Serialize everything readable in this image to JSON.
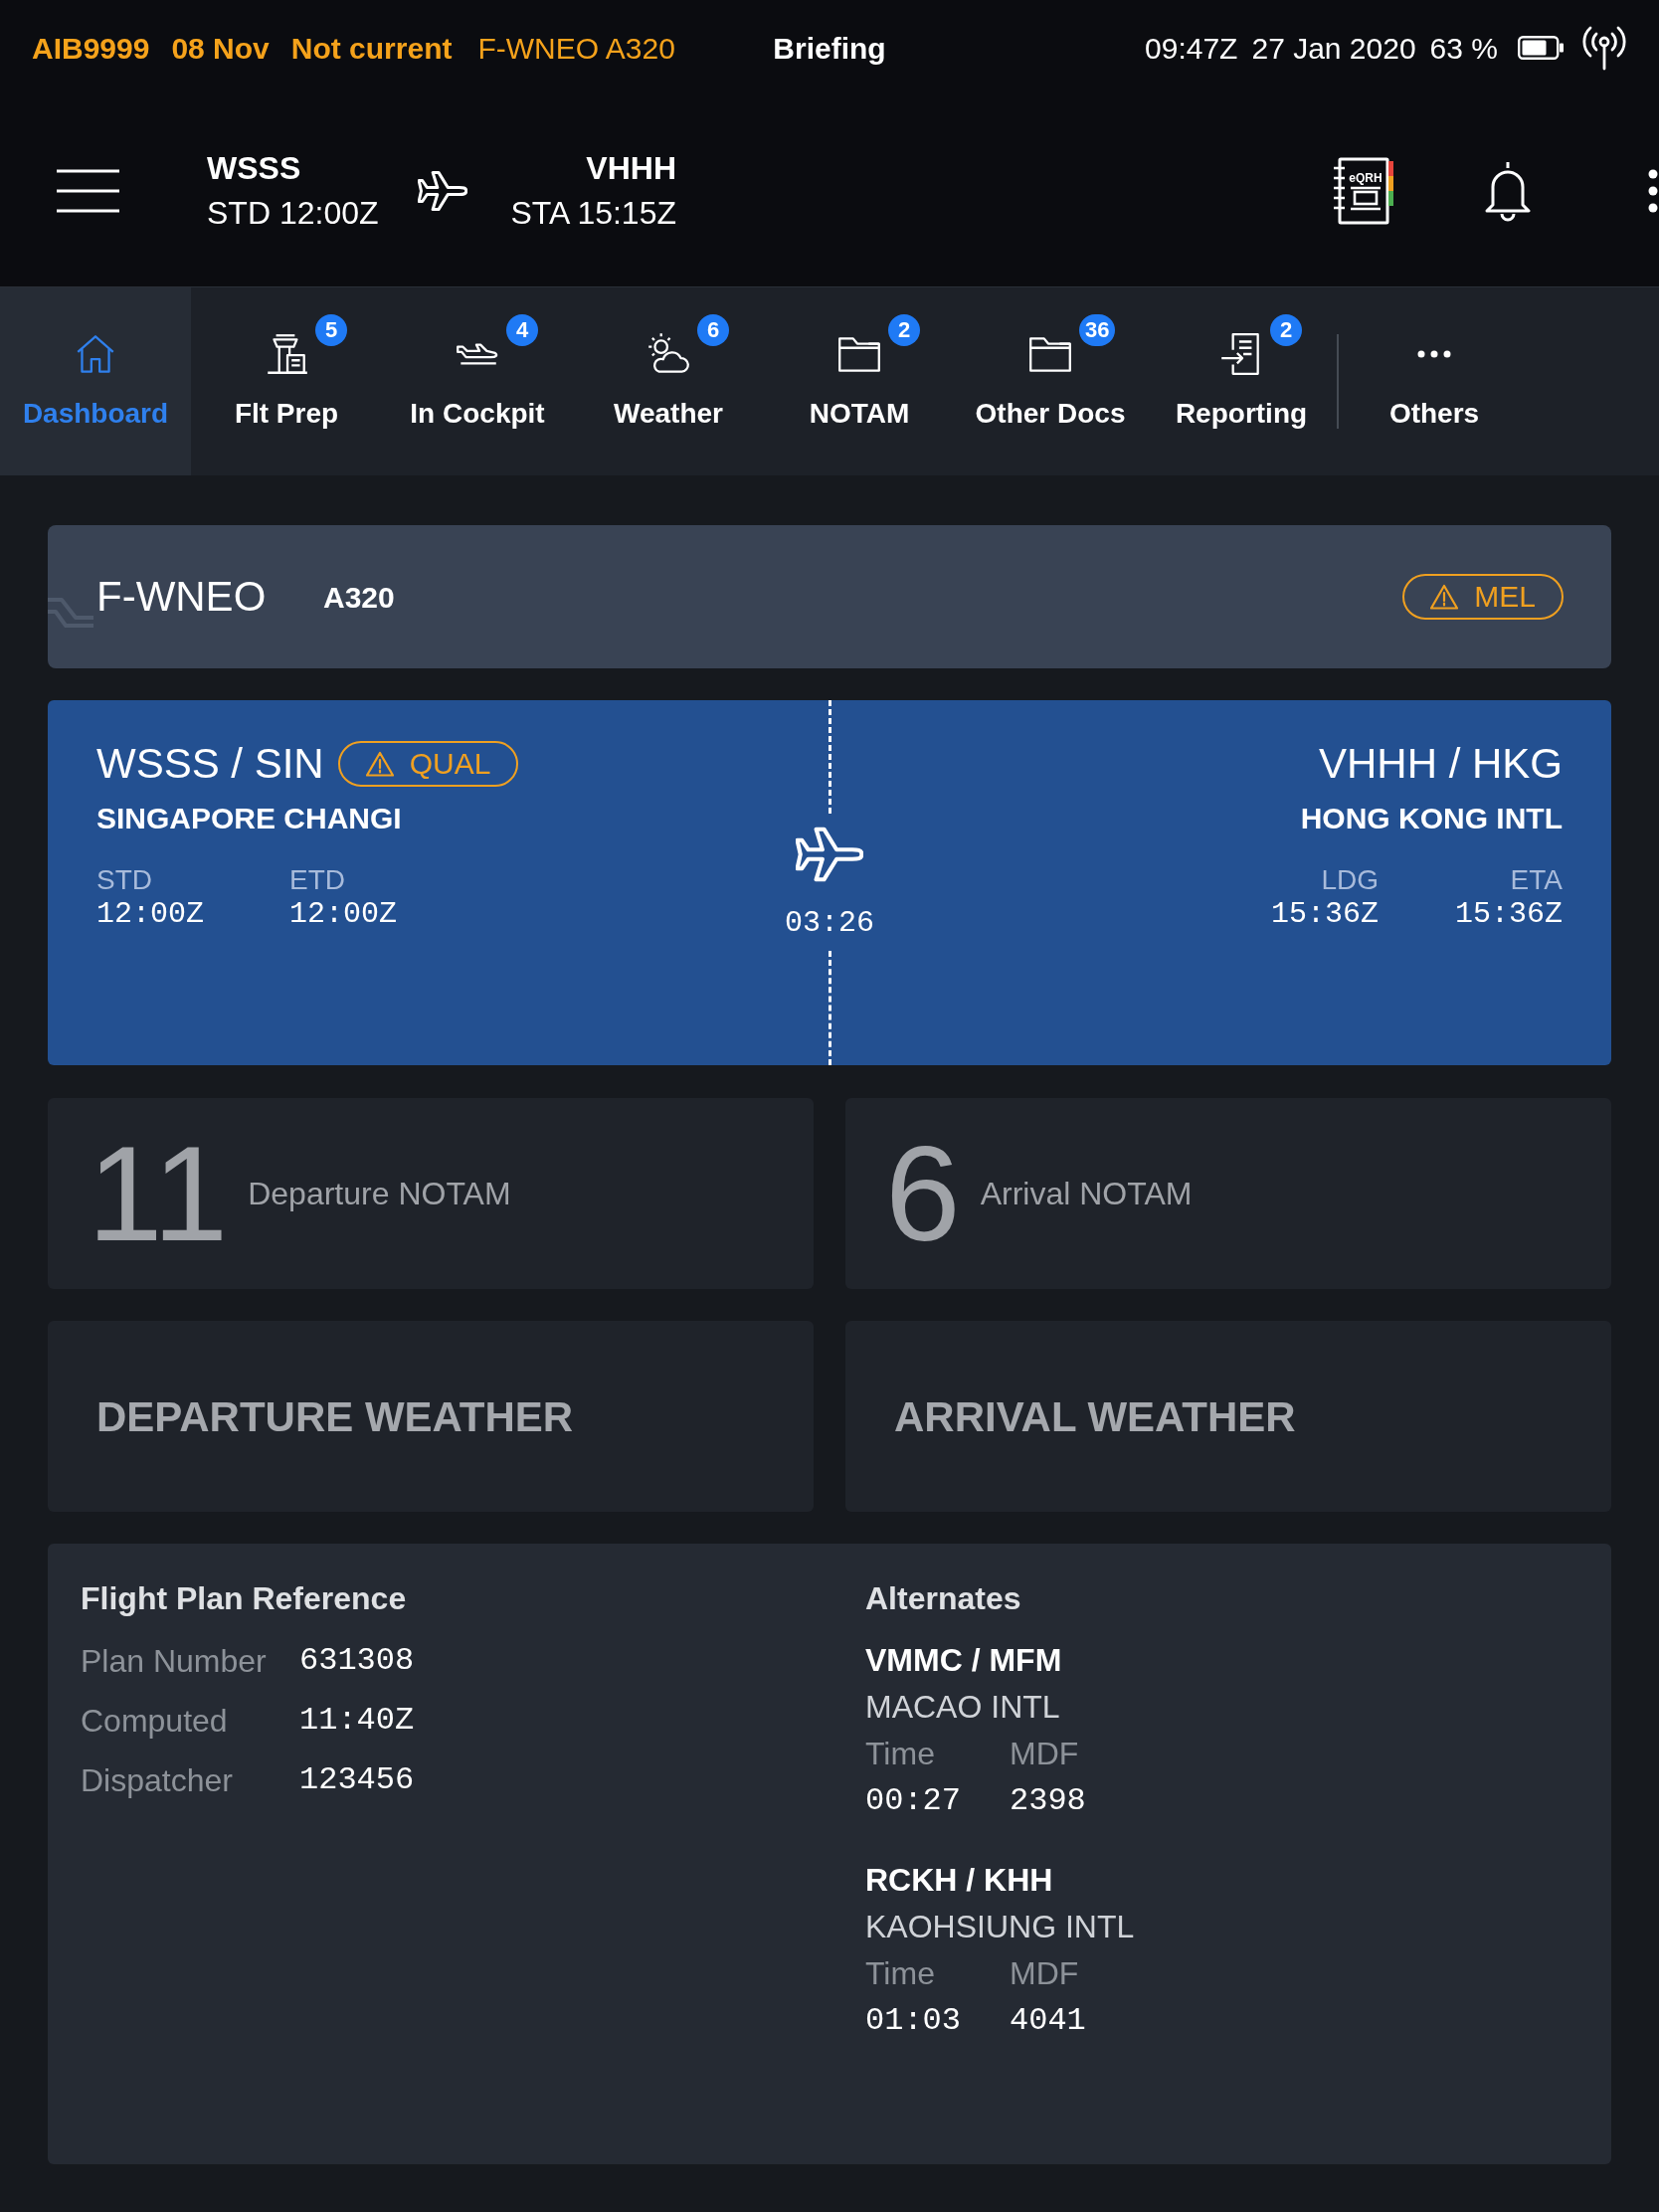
{
  "status_bar": {
    "flight": "AIB9999",
    "flight_date": "08 Nov",
    "validity": "Not current",
    "aircraft": "F-WNEO A320",
    "title": "Briefing",
    "time": "09:47Z",
    "date": "27 Jan 2020",
    "battery": "63 %"
  },
  "header": {
    "departure": {
      "code": "WSSS",
      "time": "STD 12:00Z"
    },
    "arrival": {
      "code": "VHHH",
      "time": "STA 15:15Z"
    },
    "eqrh_label": "eQRH"
  },
  "nav": {
    "tabs": [
      {
        "label": "Dashboard",
        "selected": true
      },
      {
        "label": "Flt Prep",
        "selected": false,
        "badge": "5"
      },
      {
        "label": "In Cockpit",
        "selected": false,
        "badge": "4"
      },
      {
        "label": "Weather",
        "selected": false,
        "badge": "6"
      },
      {
        "label": "NOTAM",
        "selected": false,
        "badge": "2"
      },
      {
        "label": "Other Docs",
        "selected": false,
        "badge": "36"
      },
      {
        "label": "Reporting",
        "selected": false,
        "badge": "2"
      }
    ],
    "more": {
      "label": "Others",
      "selected": false
    }
  },
  "aircraft": {
    "registration": "F-WNEO",
    "type": "A320",
    "alert": "MEL"
  },
  "route": {
    "departure": {
      "airport": "WSSS / SIN",
      "name": "SINGAPORE CHANGI",
      "alert": "QUAL",
      "times": [
        {
          "label": "STD",
          "value": "12:00Z"
        },
        {
          "label": "ETD",
          "value": "12:00Z"
        }
      ]
    },
    "duration": "03:26",
    "arrival": {
      "airport": "VHHH / HKG",
      "name": "HONG KONG INTL",
      "times": [
        {
          "label": "LDG",
          "value": "15:36Z"
        },
        {
          "label": "ETA",
          "value": "15:36Z"
        }
      ]
    }
  },
  "notams": [
    {
      "count": "11",
      "label": "Departure NOTAM"
    },
    {
      "count": "6",
      "label": "Arrival NOTAM"
    }
  ],
  "weather": [
    {
      "label": "DEPARTURE WEATHER"
    },
    {
      "label": "ARRIVAL WEATHER"
    }
  ],
  "flight_plan": {
    "title": "Flight Plan Reference",
    "rows": [
      {
        "label": "Plan Number",
        "value": "631308"
      },
      {
        "label": "Computed",
        "value": "11:40Z"
      },
      {
        "label": "Dispatcher",
        "value": "123456"
      }
    ]
  },
  "alternates": {
    "title": "Alternates",
    "items": [
      {
        "airport": "VMMC / MFM",
        "name": "MACAO INTL",
        "fields": [
          {
            "label": "Time",
            "value": "00:27"
          },
          {
            "label": "MDF",
            "value": "2398"
          }
        ]
      },
      {
        "airport": "RCKH / KHH",
        "name": "KAOHSIUNG INTL",
        "fields": [
          {
            "label": "Time",
            "value": "01:03"
          },
          {
            "label": "MDF",
            "value": "4041"
          }
        ]
      }
    ]
  }
}
